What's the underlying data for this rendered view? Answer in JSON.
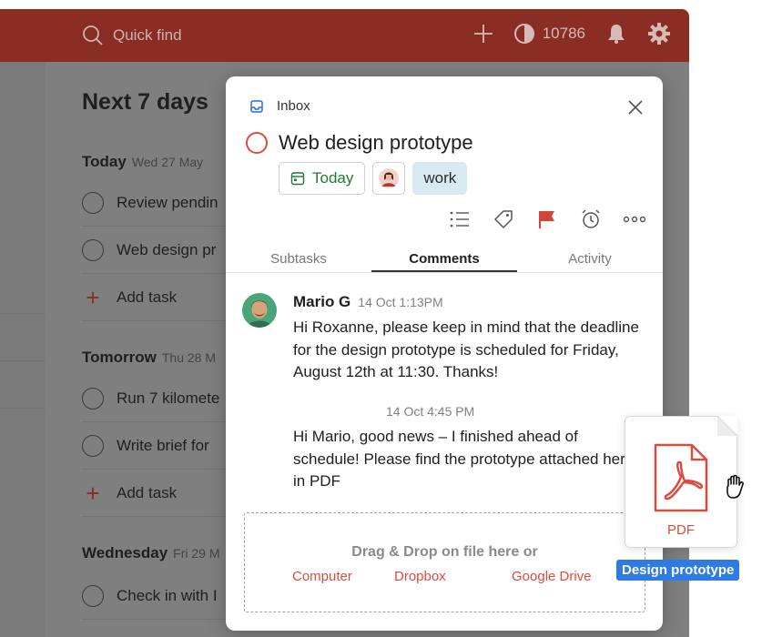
{
  "topbar": {
    "search_placeholder": "Quick find",
    "karma": "10786"
  },
  "background": {
    "page_title": "Next 7 days",
    "sections": [
      {
        "title": "Today",
        "date": "Wed 27 May",
        "tasks": [
          "Review pendin",
          "Web design pr"
        ],
        "add_label": "Add task"
      },
      {
        "title": "Tomorrow",
        "date": "Thu 28 M",
        "tasks": [
          "Run 7 kilomete",
          "Write brief for"
        ],
        "add_label": "Add task"
      },
      {
        "title": "Wednesday",
        "date": "Fri 29 M",
        "tasks": [
          "Check in with I"
        ]
      }
    ]
  },
  "modal": {
    "project": "Inbox",
    "title": "Web design prototype",
    "due_chip": "Today",
    "label_chip": "work",
    "tabs": [
      "Subtasks",
      "Comments",
      "Activity"
    ],
    "active_tab": "Comments",
    "comment": {
      "author": "Mario G",
      "time": "14 Oct 1:13PM",
      "body": "Hi Roxanne, please keep in mind that the deadline for the design prototype is scheduled for Friday, August 12th at 11:30. Thanks!"
    },
    "reply": {
      "time": "14 Oct 4:45 PM",
      "body": "Hi Mario, good news – I finished ahead of schedule! Please find the prototype attached here, in PDF"
    },
    "dropzone": {
      "text": "Drag & Drop on file here or",
      "links": [
        "Computer",
        "Dropbox",
        "Google Drive"
      ]
    }
  },
  "drag_file": {
    "type_label": "PDF",
    "name": "Design prototype"
  },
  "colors": {
    "topbar": "#8a2d24",
    "accent_red": "#dc4c3e",
    "today_green": "#1f7a33",
    "label_blue": "#d8eaf1",
    "drag_blue": "#2f7be5"
  }
}
